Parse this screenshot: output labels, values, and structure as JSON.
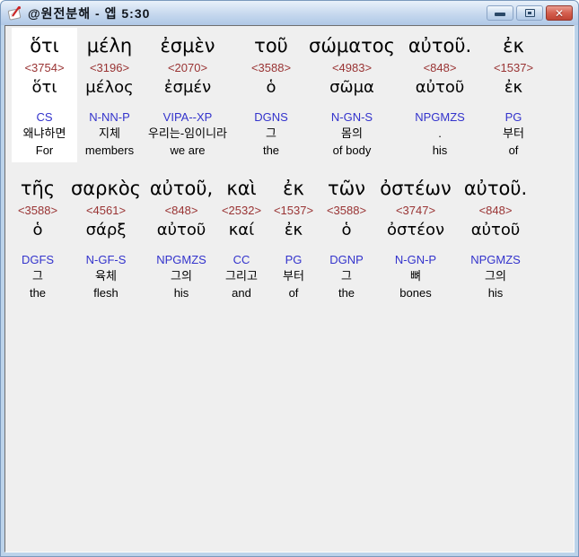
{
  "window": {
    "title": "@원전분해 - 엡 5:30",
    "reference": "엡 5:30",
    "controls": {
      "minimize": "minimize",
      "maximize": "maximize",
      "close": "close"
    }
  },
  "colors": {
    "titlebar": "#C6D8EE",
    "frame": "#BCD3EA",
    "content_background": "#EFEFEF",
    "highlight_cell": "#FFFFFF",
    "strongs_number": "#993333",
    "parsing_code": "#3333CC",
    "close_button": "#C04434"
  },
  "rows": [
    {
      "entries": [
        {
          "surface": "ὅτι",
          "strongs": "<3754>",
          "lemma": "ὅτι",
          "parsing": "CS",
          "korean": "왜냐하면",
          "english": "For",
          "highlighted": true
        },
        {
          "surface": "μέλη",
          "strongs": "<3196>",
          "lemma": "μέλος",
          "parsing": "N-NN-P",
          "korean": "지체",
          "english": "members",
          "highlighted": false
        },
        {
          "surface": "ἐσμὲν",
          "strongs": "<2070>",
          "lemma": "ἐσμέν",
          "parsing": "VIPA--XP",
          "korean": "우리는-임이니라",
          "english": "we are",
          "highlighted": false
        },
        {
          "surface": "τοῦ",
          "strongs": "<3588>",
          "lemma": "ὁ",
          "parsing": "DGNS",
          "korean": "그",
          "english": "the",
          "highlighted": false
        },
        {
          "surface": "σώματος",
          "strongs": "<4983>",
          "lemma": "σῶμα",
          "parsing": "N-GN-S",
          "korean": "몸의",
          "english": "of body",
          "highlighted": false
        },
        {
          "surface": "αὐτοῦ.",
          "strongs": "<848>",
          "lemma": "αὐτοῦ",
          "parsing": "NPGMZS",
          "korean": ".",
          "english": "his",
          "highlighted": false
        },
        {
          "surface": "ἐκ",
          "strongs": "<1537>",
          "lemma": "ἐκ",
          "parsing": "PG",
          "korean": "부터",
          "english": "of",
          "highlighted": false
        }
      ]
    },
    {
      "entries": [
        {
          "surface": "τῆς",
          "strongs": "<3588>",
          "lemma": "ὁ",
          "parsing": "DGFS",
          "korean": "그",
          "english": "the",
          "highlighted": false
        },
        {
          "surface": "σαρκὸς",
          "strongs": "<4561>",
          "lemma": "σάρξ",
          "parsing": "N-GF-S",
          "korean": "육체",
          "english": "flesh",
          "highlighted": false
        },
        {
          "surface": "αὐτοῦ,",
          "strongs": "<848>",
          "lemma": "αὐτοῦ",
          "parsing": "NPGMZS",
          "korean": "그의",
          "english": "his",
          "highlighted": false
        },
        {
          "surface": "καὶ",
          "strongs": "<2532>",
          "lemma": "καί",
          "parsing": "CC",
          "korean": "그리고",
          "english": "and",
          "highlighted": false
        },
        {
          "surface": "ἐκ",
          "strongs": "<1537>",
          "lemma": "ἐκ",
          "parsing": "PG",
          "korean": "부터",
          "english": "of",
          "highlighted": false
        },
        {
          "surface": "τῶν",
          "strongs": "<3588>",
          "lemma": "ὁ",
          "parsing": "DGNP",
          "korean": "그",
          "english": "the",
          "highlighted": false
        },
        {
          "surface": "ὀστέων",
          "strongs": "<3747>",
          "lemma": "ὀστέον",
          "parsing": "N-GN-P",
          "korean": "뼈",
          "english": "bones",
          "highlighted": false
        },
        {
          "surface": "αὐτοῦ.",
          "strongs": "<848>",
          "lemma": "αὐτοῦ",
          "parsing": "NPGMZS",
          "korean": "그의",
          "english": "his",
          "highlighted": false
        }
      ]
    }
  ]
}
